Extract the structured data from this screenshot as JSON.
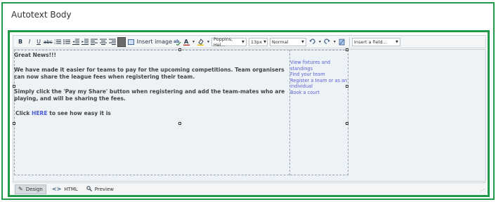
{
  "header": {
    "title": "Autotext Body"
  },
  "toolbar": {
    "insert_image_label": "Insert image",
    "font_family": "Poppins, Hel...",
    "font_size": "13px",
    "paragraph_style": "Normal",
    "insert_field": "Insert a field..."
  },
  "content": {
    "p1": "Great News!!!",
    "p2": "We have made it easier for teams to pay for the upcoming competitions. Team organisers can now share the league fees when registering their team.",
    "p3": "Simply click the 'Pay my Share' button when registering and add the team-mates who are playing, and will be sharing the fees.",
    "p4_pre": "Click ",
    "p4_link": "HERE",
    "p4_post": " to see how easy it is"
  },
  "links": [
    "View fixtures and standings",
    "Find your team",
    "Register a team or as an individual",
    "Book a court"
  ],
  "modes": {
    "design": "Design",
    "html": "HTML",
    "preview": "Preview"
  }
}
